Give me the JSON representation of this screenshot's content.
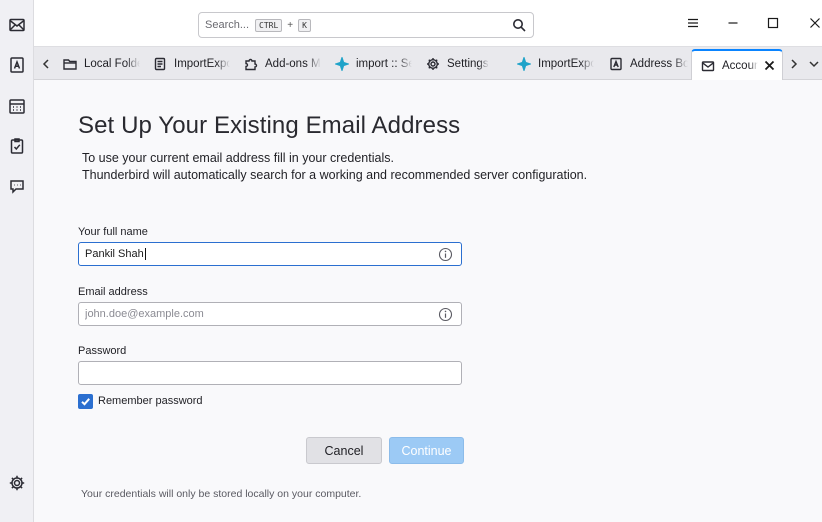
{
  "spaces": {
    "items": [
      {
        "name": "mail",
        "icon": "mail-icon"
      },
      {
        "name": "address-book",
        "icon": "address-book-icon"
      },
      {
        "name": "calendar",
        "icon": "calendar-icon"
      },
      {
        "name": "tasks",
        "icon": "tasks-icon"
      },
      {
        "name": "chat",
        "icon": "chat-icon"
      }
    ],
    "settings_icon": "gear-icon"
  },
  "titlebar": {
    "search": {
      "placeholder": "Search...",
      "shortcut_key1": "CTRL",
      "shortcut_plus": "+",
      "shortcut_key2": "K"
    }
  },
  "tabs": [
    {
      "label": "Local Folders",
      "icon": "folder-icon"
    },
    {
      "label": "ImportExport",
      "icon": "document-icon"
    },
    {
      "label": "Add-ons Manager",
      "icon": "puzzle-icon"
    },
    {
      "label": "import :: Search",
      "icon": "addon-star-icon"
    },
    {
      "label": "Settings",
      "icon": "gear-icon"
    },
    {
      "label": "ImportExport",
      "icon": "addon-star-icon"
    },
    {
      "label": "Address Book",
      "icon": "address-book-icon"
    },
    {
      "label": "Account Setup",
      "icon": "mail-icon",
      "active": true
    }
  ],
  "main": {
    "heading": "Set Up Your Existing Email Address",
    "intro_line1": "To use your current email address fill in your credentials.",
    "intro_line2": "Thunderbird will automatically search for a working and recommended server configuration.",
    "fields": {
      "full_name": {
        "label": "Your full name",
        "value": "Pankil Shah"
      },
      "email": {
        "label": "Email address",
        "placeholder": "john.doe@example.com",
        "value": ""
      },
      "password": {
        "label": "Password",
        "value": ""
      }
    },
    "remember_password": {
      "label": "Remember password",
      "checked": true
    },
    "buttons": {
      "cancel": "Cancel",
      "continue": "Continue"
    },
    "footer_note": "Your credentials will only be stored locally on your computer."
  },
  "colors": {
    "accent": "#2b6fd0",
    "continue_disabled": "#9ccaf5",
    "addon_icon": "#1fa3c9"
  }
}
